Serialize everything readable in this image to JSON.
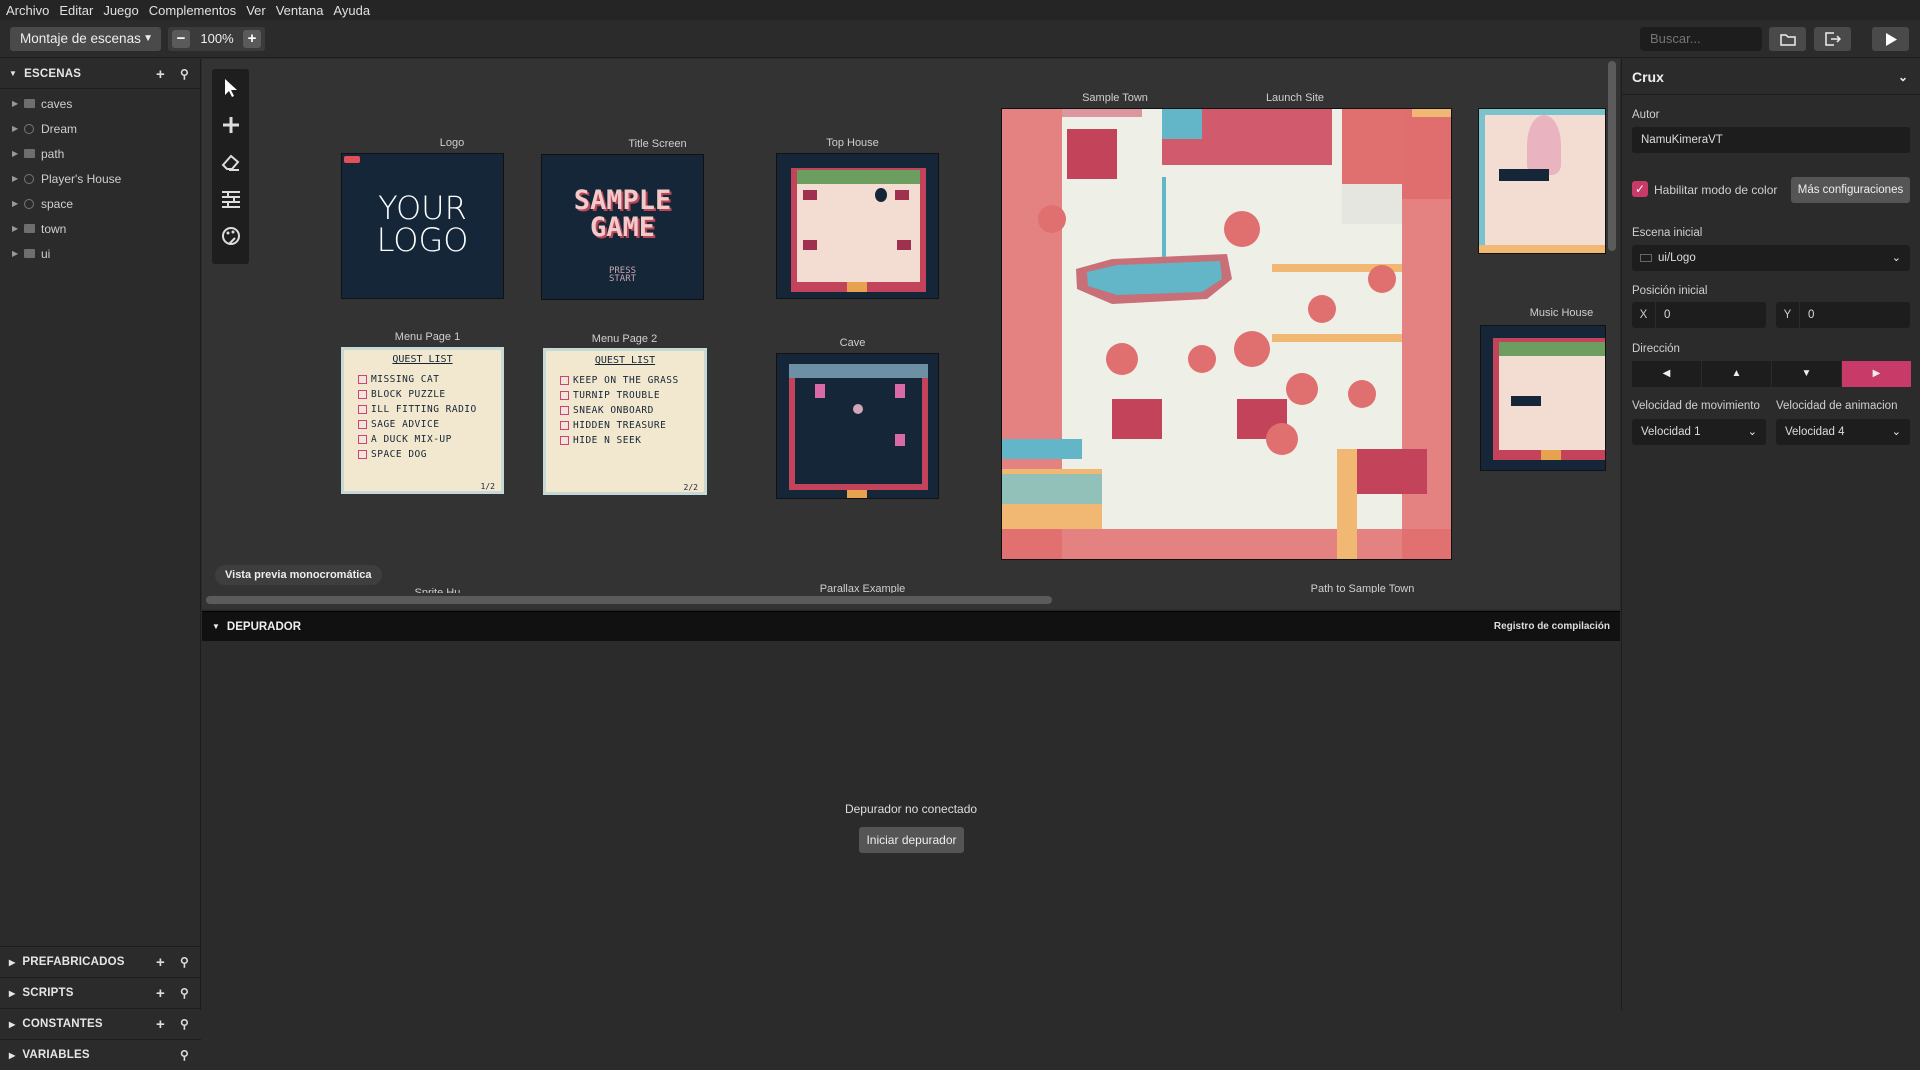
{
  "menu": [
    "Archivo",
    "Editar",
    "Juego",
    "Complementos",
    "Ver",
    "Ventana",
    "Ayuda"
  ],
  "toolbar": {
    "view_mode": "Montaje de escenas",
    "zoom": "100%",
    "search_placeholder": "Buscar..."
  },
  "sidebar": {
    "scenes_title": "ESCENAS",
    "items": [
      {
        "label": "caves",
        "kind": "folder"
      },
      {
        "label": "Dream",
        "kind": "globe"
      },
      {
        "label": "path",
        "kind": "folder"
      },
      {
        "label": "Player's House",
        "kind": "globe"
      },
      {
        "label": "space",
        "kind": "globe"
      },
      {
        "label": "town",
        "kind": "folder"
      },
      {
        "label": "ui",
        "kind": "folder"
      }
    ],
    "bottom": [
      "PREFABRICADOS",
      "SCRIPTS",
      "CONSTANTES",
      "VARIABLES"
    ]
  },
  "canvas": {
    "scenes": {
      "logo": "Logo",
      "title": "Title Screen",
      "tophouse": "Top House",
      "town": "Sample Town",
      "launch": "Launch Site",
      "menu1": "Menu Page 1",
      "menu2": "Menu Page 2",
      "cave": "Cave",
      "music": "Music House",
      "parallax": "Parallax Example",
      "path": "Path to Sample Town",
      "sprite": "Sprite Hu..."
    },
    "logo_text": [
      "YOUR",
      "LOGO"
    ],
    "title_text": [
      "SAMPLE",
      "GAME"
    ],
    "title_press": [
      "PRESS",
      "START"
    ],
    "quest_title": "QUEST LIST",
    "menu1_items": [
      "MISSING CAT",
      "BLOCK PUZZLE",
      "ILL FITTING RADIO",
      "SAGE ADVICE",
      "A DUCK MIX-UP",
      "SPACE DOG"
    ],
    "menu1_page": "1/2",
    "menu2_items": [
      "KEEP ON THE GRASS",
      "TURNIP TROUBLE",
      "SNEAK ONBOARD",
      "HIDDEN TREASURE",
      "HIDE N SEEK"
    ],
    "menu2_page": "2/2",
    "mono_preview": "Vista previa monocromática"
  },
  "debugger": {
    "title": "DEPURADOR",
    "log": "Registro de compilación",
    "status": "Depurador no conectado",
    "start": "Iniciar depurador"
  },
  "props": {
    "title": "Crux",
    "author_label": "Autor",
    "author": "NamuKimeraVT",
    "color_mode": "Habilitar modo de color",
    "more": "Más configuraciones",
    "start_scene_label": "Escena inicial",
    "start_scene": "ui/Logo",
    "start_pos_label": "Posición inicial",
    "x_label": "X",
    "x": "0",
    "y_label": "Y",
    "y": "0",
    "direction_label": "Dirección",
    "direction_selected": "right",
    "move_speed_label": "Velocidad de movimiento",
    "move_speed": "Velocidad 1",
    "anim_speed_label": "Velocidad de animacion",
    "anim_speed": "Velocidad 4"
  },
  "colors": {
    "accent": "#c83a68",
    "paper": "#f2e7cf",
    "navy": "#142637",
    "brick": "#c2435a",
    "tree": "#e06f6f",
    "water": "#62b6c7"
  }
}
